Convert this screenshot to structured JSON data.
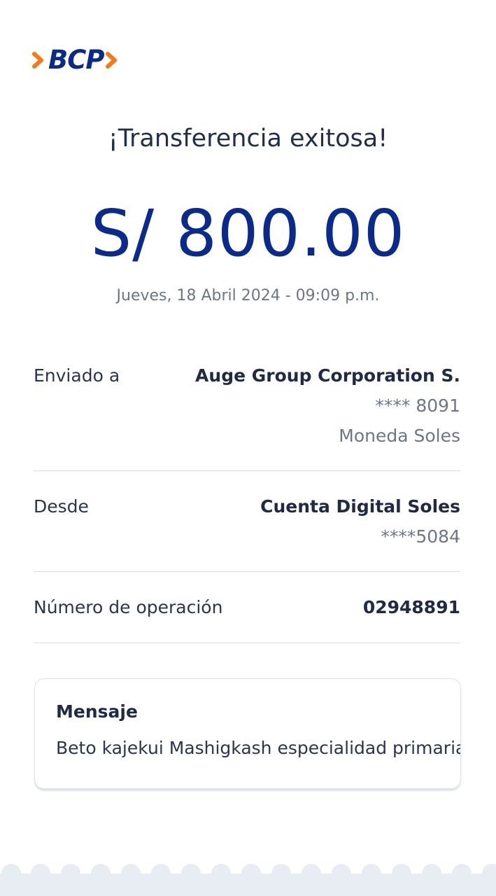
{
  "brand": {
    "logo_text": "BCP",
    "accent": "#f27a1a",
    "primary": "#0a2a8c"
  },
  "header": {
    "title": "¡Transferencia exitosa!"
  },
  "transfer": {
    "amount": "S/ 800.00",
    "datetime": "Jueves, 18 Abril 2024 - 09:09 p.m."
  },
  "details": {
    "sent_to": {
      "label": "Enviado a",
      "name": "Auge Group Corporation S.",
      "account": "**** 8091",
      "currency": "Moneda Soles"
    },
    "from": {
      "label": "Desde",
      "account_name": "Cuenta Digital Soles",
      "account": "****5084"
    },
    "operation": {
      "label": "Número de operación",
      "number": "02948891"
    }
  },
  "message": {
    "title": "Mensaje",
    "text": "Beto kajekui Mashigkash especialidad primaria"
  }
}
